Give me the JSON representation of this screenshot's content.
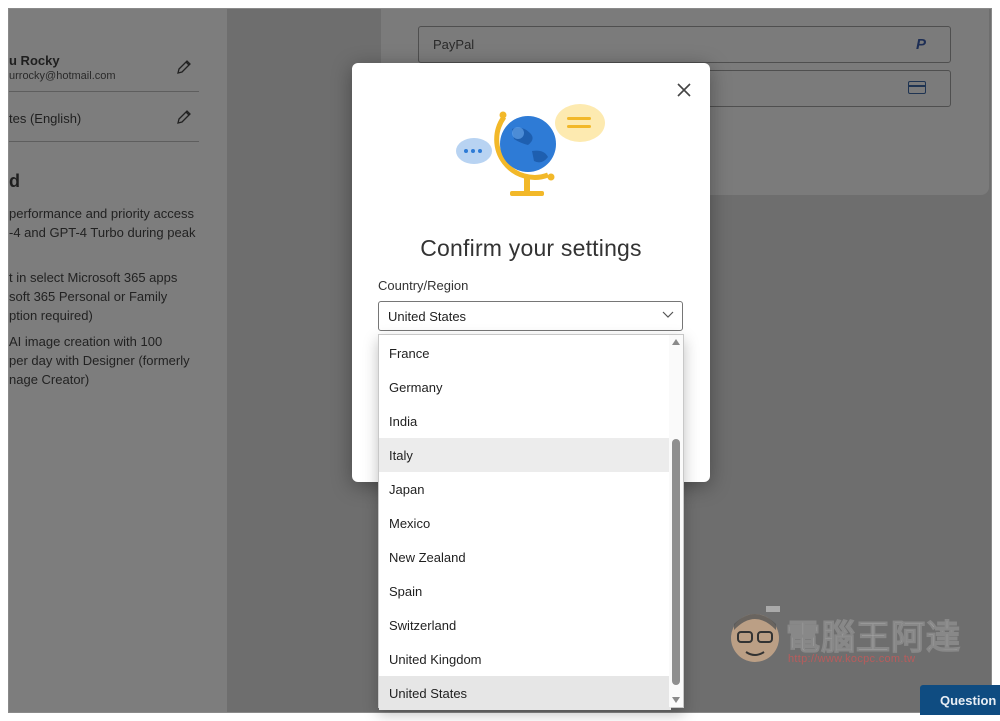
{
  "background": {
    "profile": {
      "name": "u Rocky",
      "email": "urrocky@hotmail.com",
      "language": "tes (English)"
    },
    "plan_heading": "d",
    "benefits": [
      "performance and priority access",
      "-4 and GPT-4 Turbo during peak",
      "t in select Microsoft 365 apps",
      "soft 365 Personal or Family",
      "ption required)",
      "AI image creation with 100",
      "per day with Designer (formerly",
      "nage Creator)"
    ],
    "payment_methods": [
      "PayPal",
      ""
    ],
    "icons": {
      "paypal": "paypal-icon",
      "card": "credit-card-icon",
      "edit": "pencil-icon"
    }
  },
  "modal": {
    "title": "Confirm your settings",
    "country_label": "Country/Region",
    "selected_country": "United States",
    "icons": {
      "close": "close-icon",
      "illustration": "globe-illustration",
      "dropdown": "chevron-down-icon"
    }
  },
  "dropdown": {
    "options": [
      "France",
      "Germany",
      "India",
      "Italy",
      "Japan",
      "Mexico",
      "New Zealand",
      "Spain",
      "Switzerland",
      "United Kingdom",
      "United States"
    ],
    "hovered": "Italy",
    "selected": "United States"
  },
  "watermark": {
    "title": "電腦王阿達",
    "url": "http://www.kocpc.com.tw"
  },
  "footer": {
    "question_button": "Question"
  },
  "colors": {
    "accent": "#0f4c81",
    "overlay": "#707070",
    "globe_blue": "#2e7bd6",
    "globe_stand": "#f2b829"
  }
}
